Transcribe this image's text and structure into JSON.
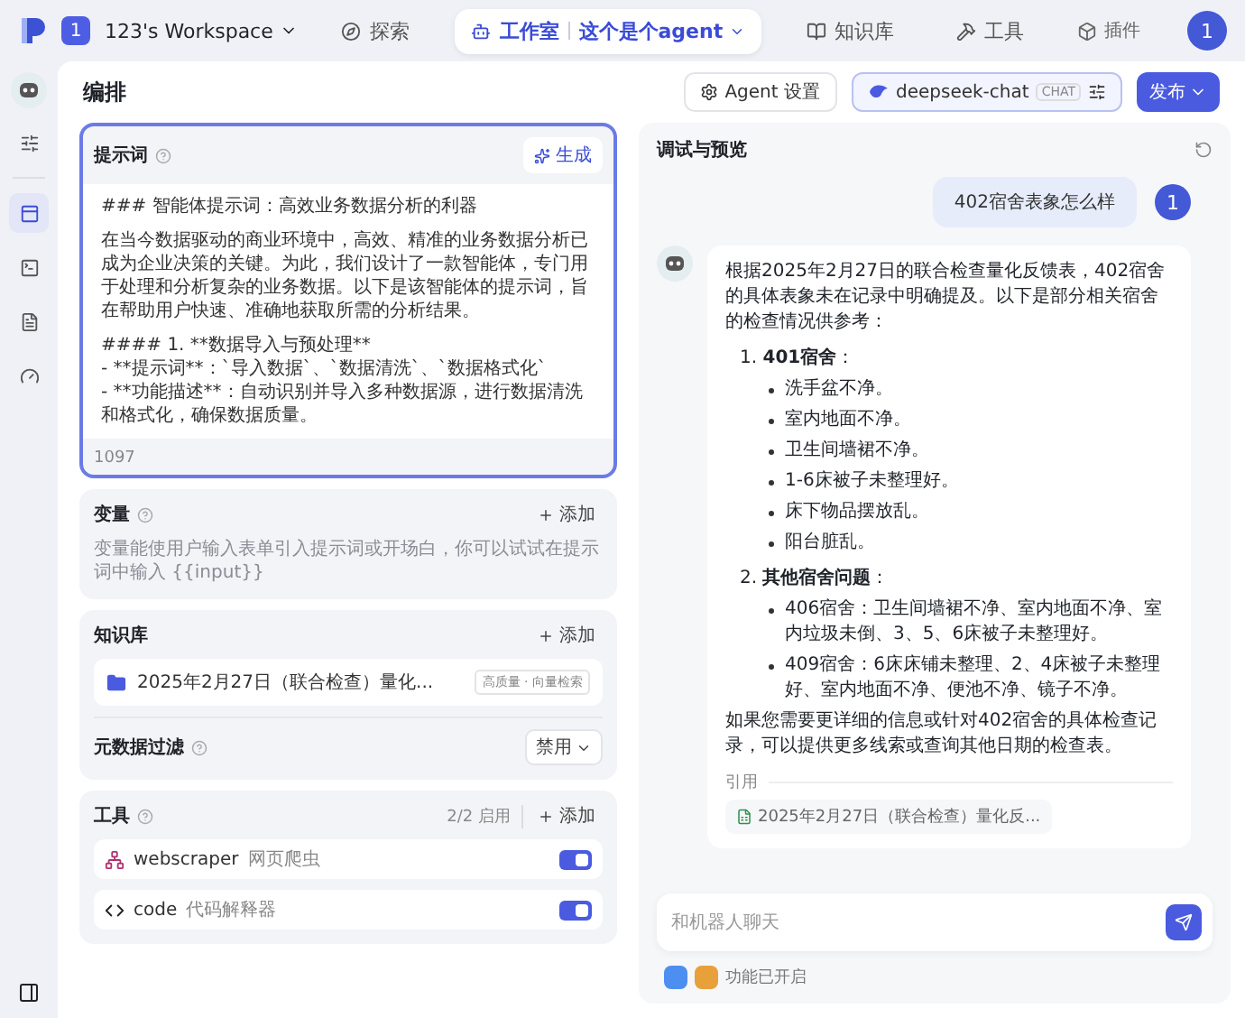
{
  "topbar": {
    "workspace_badge": "1",
    "workspace": "123's Workspace",
    "nav": [
      {
        "kind": "explore",
        "label": "探索",
        "selected": false
      },
      {
        "kind": "studio",
        "label": "工作室",
        "selected": true,
        "sub": "这个是个agent"
      },
      {
        "kind": "knowledge",
        "label": "知识库",
        "selected": false
      },
      {
        "kind": "tools",
        "label": "工具",
        "selected": false
      }
    ],
    "plugin": "插件",
    "avatar": "1"
  },
  "rail": [
    {
      "kind": "settings",
      "selected": false
    },
    {
      "kind": "layout",
      "selected": true
    },
    {
      "kind": "terminal",
      "selected": false
    },
    {
      "kind": "file",
      "selected": false
    },
    {
      "kind": "gauge",
      "selected": false
    }
  ],
  "header": {
    "title": "编排",
    "agent_settings": "Agent 设置",
    "model": {
      "name": "deepseek-chat",
      "tag": "CHAT"
    },
    "publish": "发布"
  },
  "prompt": {
    "title": "提示词",
    "generate": "生成",
    "count": "1097",
    "paragraphs": [
      [
        "### 智能体提示词：高效业务数据分析的利器"
      ],
      [
        "在当今数据驱动的商业环境中，高效、精准的业务数据分析已成为企业决策的关键。为此，我们设计了一款智能体，专门用于处理和分析复杂的业务数据。以下是该智能体的提示词，旨在帮助用户快速、准确地获取所需的分析结果。"
      ],
      [
        "#### 1. **数据导入与预处理**",
        "- **提示词**：`导入数据`、`数据清洗`、`数据格式化`",
        "- **功能描述**：自动识别并导入多种数据源，进行数据清洗和格式化，确保数据质量。"
      ]
    ]
  },
  "variables": {
    "title": "变量",
    "add": "添加",
    "hint": "变量能使用户输入表单引入提示词或开场白，你可以试试在提示词中输入 {{input}}"
  },
  "knowledge": {
    "title": "知识库",
    "add": "添加",
    "items": [
      {
        "name": "2025年2月27日（联合检查）量化...",
        "tag": "高质量 · 向量检索"
      }
    ],
    "filter": {
      "label": "元数据过滤",
      "value": "禁用"
    }
  },
  "tools": {
    "title": "工具",
    "count": "2/2 启用",
    "add": "添加",
    "items": [
      {
        "kind": "scraper",
        "name": "webscraper",
        "desc": "网页爬虫",
        "on": true
      },
      {
        "kind": "code",
        "name": "code",
        "desc": "代码解释器",
        "on": true
      }
    ]
  },
  "preview": {
    "title": "调试与预览",
    "user_message": {
      "avatar": "1",
      "text": "402宿舍表象怎么样"
    },
    "bot_message": {
      "intro": "根据2025年2月27日的联合检查量化反馈表，402宿舍的具体表象未在记录中明确提及。以下是部分相关宿舍的检查情况供参考：",
      "sections": [
        {
          "heading": "1. **401宿舍**：",
          "items": [
            "洗手盆不净。",
            "室内地面不净。",
            "卫生间墙裙不净。",
            "1-6床被子未整理好。",
            "床下物品摆放乱。",
            "阳台脏乱。"
          ]
        },
        {
          "heading": "2. **其他宿舍问题**：",
          "items": [
            "406宿舍：卫生间墙裙不净、室内地面不净、室内垃圾未倒、3、5、6床被子未整理好。",
            "409宿舍：6床床铺未整理、2、4床被子未整理好、室内地面不净、便池不净、镜子不净。"
          ]
        }
      ],
      "outro": "如果您需要更详细的信息或针对402宿舍的具体检查记录，可以提供更多线索或查询其他日期的检查表。",
      "citation_label": "引用",
      "citations": [
        "2025年2月27日（联合检查）量化反..."
      ]
    },
    "input": {
      "placeholder": "和机器人聊天"
    },
    "features": "功能已开启"
  }
}
